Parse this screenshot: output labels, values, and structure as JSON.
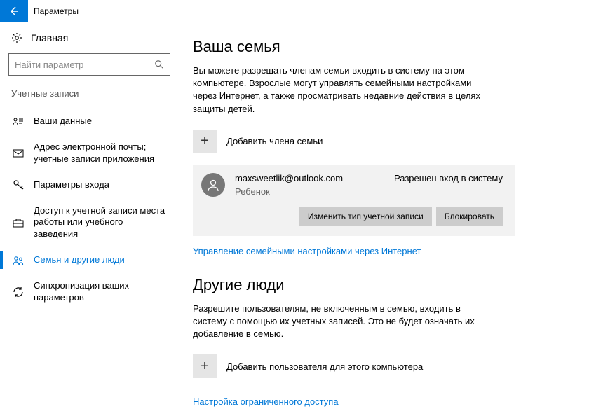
{
  "titlebar": {
    "title": "Параметры"
  },
  "sidebar": {
    "home": "Главная",
    "search_placeholder": "Найти параметр",
    "section": "Учетные записи",
    "items": [
      {
        "label": "Ваши данные"
      },
      {
        "label": "Адрес электронной почты; учетные записи приложения"
      },
      {
        "label": "Параметры входа"
      },
      {
        "label": "Доступ к учетной записи места работы или учебного заведения"
      },
      {
        "label": "Семья и другие люди"
      },
      {
        "label": "Синхронизация ваших параметров"
      }
    ]
  },
  "main": {
    "family": {
      "heading": "Ваша семья",
      "desc": "Вы можете разрешать членам семьи входить в систему на этом компьютере. Взрослые могут управлять семейными настройками через Интернет, а также просматривать недавние действия в целях защиты детей.",
      "add": "Добавить члена семьи",
      "member": {
        "email": "maxsweetlik@outlook.com",
        "role": "Ребенок",
        "status": "Разрешен вход в систему",
        "change_type": "Изменить тип учетной записи",
        "block": "Блокировать"
      },
      "manage_link": "Управление семейными настройками через Интернет"
    },
    "other": {
      "heading": "Другие люди",
      "desc": "Разрешите пользователям, не включенным в семью, входить в систему с помощью их учетных записей. Это не будет означать их добавление в семью.",
      "add": "Добавить пользователя для этого компьютера",
      "restricted_link": "Настройка ограниченного доступа"
    }
  }
}
